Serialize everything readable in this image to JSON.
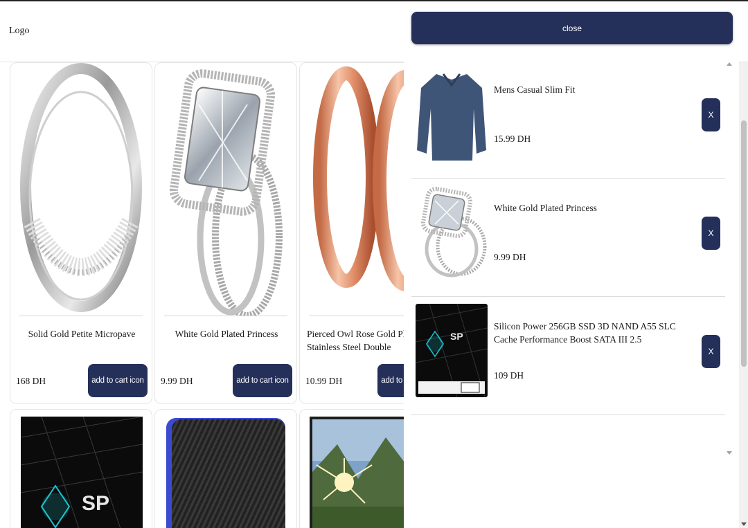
{
  "header": {
    "logo": "Logo"
  },
  "products": [
    {
      "title": "Solid Gold Petite Micropave",
      "price": "168 DH",
      "button": "add to cart icon",
      "image": "silver-ring-image"
    },
    {
      "title": "White Gold Plated Princess",
      "price": "9.99 DH",
      "button": "add to cart icon",
      "image": "diamond-ring-image"
    },
    {
      "title": "Pierced Owl Rose Gold Plated Stainless Steel Double",
      "price": "10.99 DH",
      "button": "add to cart icon",
      "image": "rose-gold-rings-image"
    },
    {
      "image": "ssd-image"
    },
    {
      "image": "external-drive-image"
    },
    {
      "image": "monitor-landscape-image"
    }
  ],
  "cart": {
    "close_label": "close",
    "items": [
      {
        "name": "Mens Casual Slim Fit",
        "price": "15.99 DH",
        "remove": "X",
        "image": "blue-shirt-image"
      },
      {
        "name": "White Gold Plated Princess",
        "price": "9.99 DH",
        "remove": "X",
        "image": "diamond-ring-image"
      },
      {
        "name": "Silicon Power 256GB SSD 3D NAND A55 SLC Cache Performance Boost SATA III 2.5",
        "price": "109 DH",
        "remove": "X",
        "image": "ssd-image"
      }
    ]
  },
  "colors": {
    "accent": "#25305a",
    "border": "#e6e6e6",
    "divider": "#dcdcdc"
  }
}
